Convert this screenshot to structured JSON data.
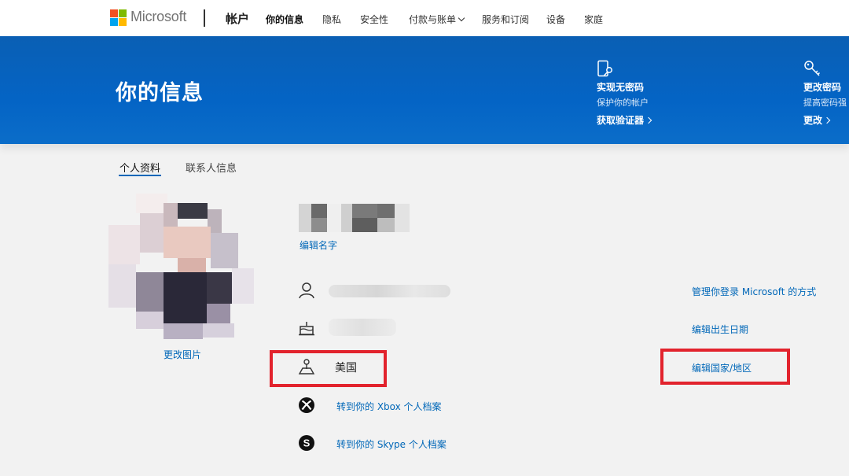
{
  "header": {
    "brand": "Microsoft",
    "section": "帐户",
    "nav": [
      {
        "label": "你的信息",
        "active": true
      },
      {
        "label": "隐私",
        "active": false
      },
      {
        "label": "安全性",
        "active": false
      },
      {
        "label": "付款与账单",
        "active": false,
        "dropdown": true
      },
      {
        "label": "服务和订阅",
        "active": false
      },
      {
        "label": "设备",
        "active": false
      },
      {
        "label": "家庭",
        "active": false
      }
    ]
  },
  "banner": {
    "title": "你的信息",
    "promos": [
      {
        "title": "实现无密码",
        "subtitle": "保护你的帐户",
        "link": "获取验证器",
        "icon": "phone-key-icon"
      },
      {
        "title": "更改密码",
        "subtitle": "提高密码强",
        "link": "更改",
        "icon": "key-icon"
      }
    ]
  },
  "tabs": [
    {
      "label": "个人资料",
      "active": true
    },
    {
      "label": "联系人信息",
      "active": false
    }
  ],
  "profile": {
    "change_picture": "更改图片",
    "edit_name": "编辑名字",
    "country": "美国",
    "xbox_link": "转到你的 Xbox 个人档案",
    "skype_link": "转到你的 Skype 个人档案"
  },
  "right_links": {
    "manage_signin": "管理你登录 Microsoft 的方式",
    "edit_birthdate": "编辑出生日期",
    "edit_country": "编辑国家/地区"
  },
  "colors": {
    "banner_blue": "#0464c5",
    "link_blue": "#0067b8",
    "highlight_red": "#e2232d"
  }
}
